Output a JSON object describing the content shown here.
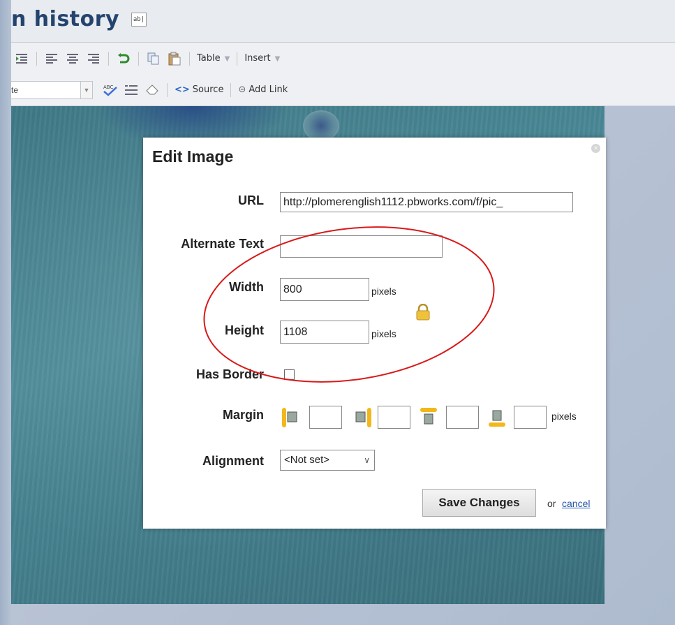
{
  "page": {
    "title": "n history",
    "title_edit_icon": "ab|"
  },
  "toolbar": {
    "row1": {
      "indent_icon": "indent-icon",
      "align_left_icon": "align-left-icon",
      "align_center_icon": "align-center-icon",
      "align_right_icon": "align-right-icon",
      "undo_icon": "undo-icon",
      "copy_icon": "copy-icon",
      "paste_icon": "paste-icon",
      "table_label": "Table",
      "insert_label": "Insert"
    },
    "row2": {
      "style_value": "te",
      "spellcheck_icon": "spellcheck-icon",
      "list_icon": "list-icon",
      "eraser_icon": "eraser-icon",
      "source_label": "Source",
      "add_link_label": "Add Link"
    }
  },
  "dialog": {
    "title": "Edit Image",
    "close_glyph": "×",
    "url_label": "URL",
    "url_value": "http://plomerenglish1112.pbworks.com/f/pic_",
    "alt_label": "Alternate Text",
    "alt_value": "",
    "width_label": "Width",
    "width_value": "800",
    "height_label": "Height",
    "height_value": "1108",
    "pixels_unit": "pixels",
    "border_label": "Has Border",
    "border_checked": false,
    "margin_label": "Margin",
    "margin_values": [
      "",
      "",
      "",
      ""
    ],
    "alignment_label": "Alignment",
    "alignment_value": "<Not set>",
    "save_label": "Save Changes",
    "or_text": "or",
    "cancel_label": "cancel"
  },
  "colors": {
    "annotation_circle": "#d81a1a",
    "title_color": "#24446f",
    "margin_indicator": "#f2b81a"
  }
}
